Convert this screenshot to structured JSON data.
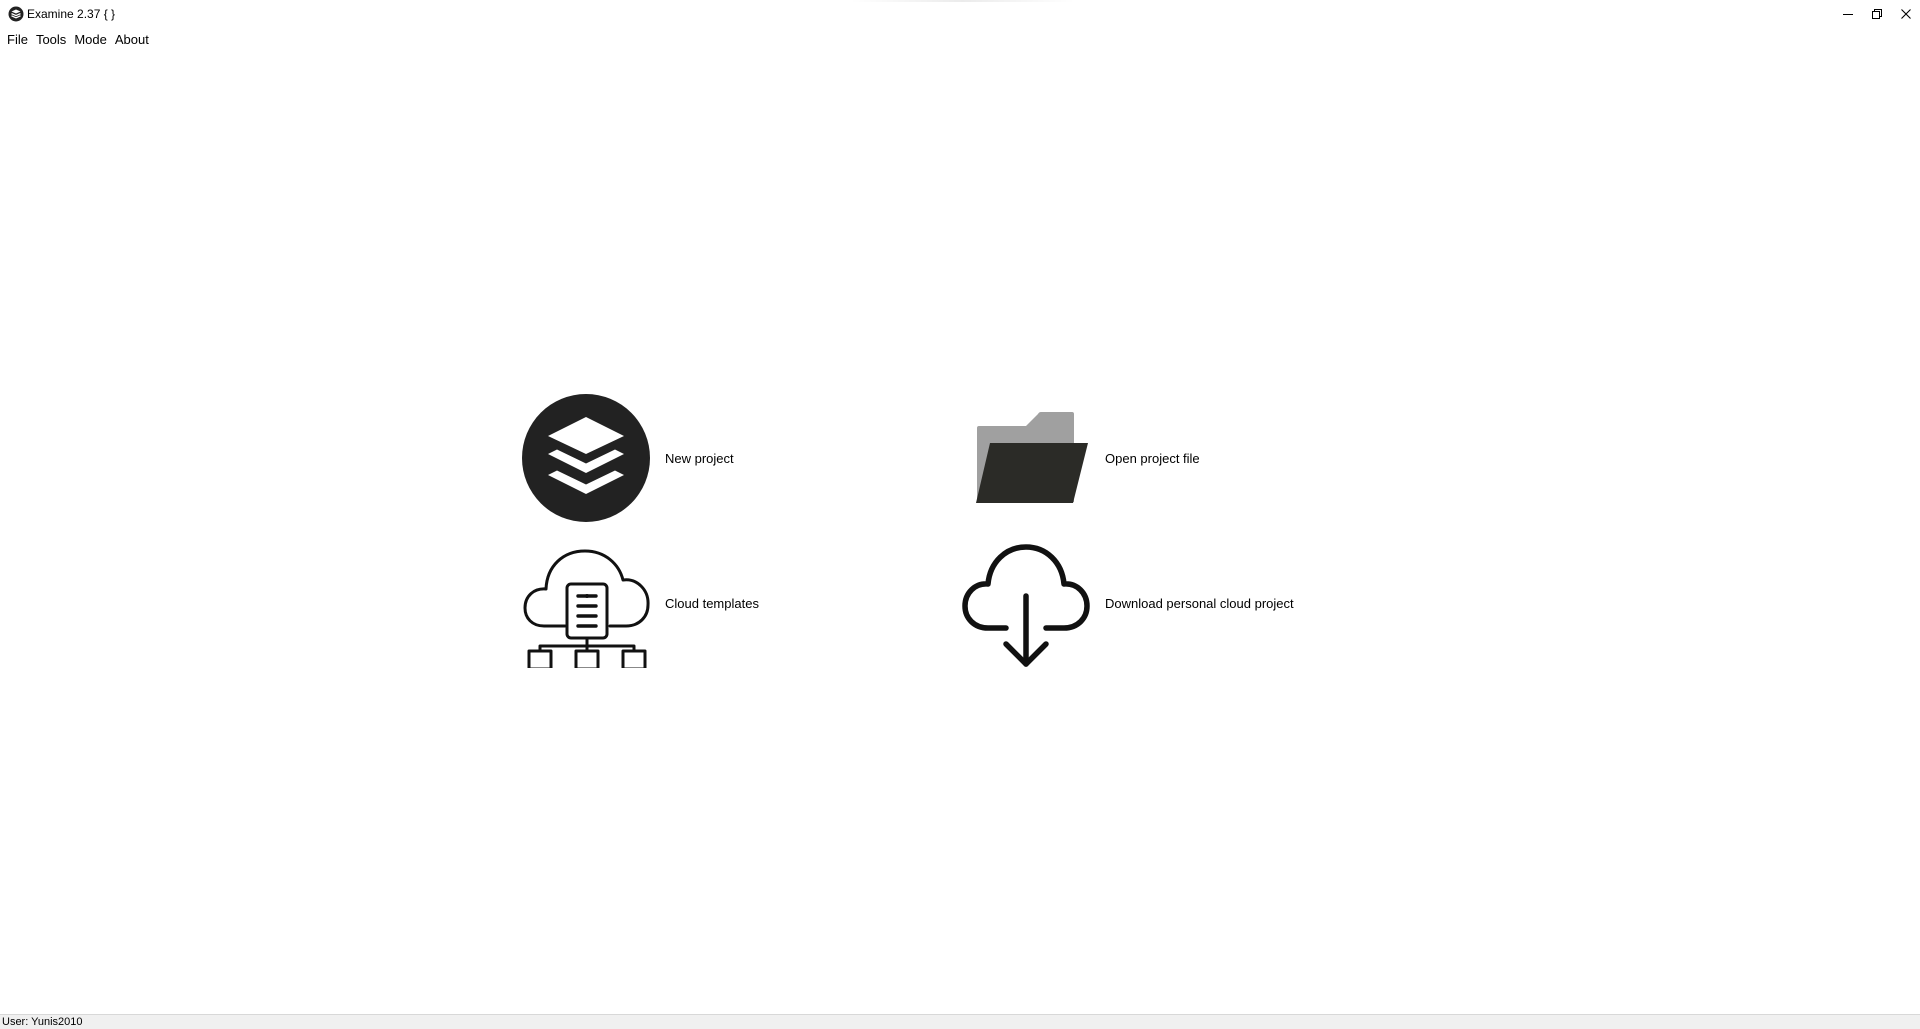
{
  "window": {
    "title": "Examine 2.37 {  }",
    "icon": "layers-icon",
    "controls": {
      "minimize": "minimize-icon",
      "restore": "restore-icon",
      "close": "close-icon"
    }
  },
  "menu": {
    "items": [
      "File",
      "Tools",
      "Mode",
      "About"
    ]
  },
  "start": {
    "new_project": {
      "label": "New project",
      "icon": "layers-icon"
    },
    "open_project": {
      "label": "Open project file",
      "icon": "folder-icon"
    },
    "cloud_templates": {
      "label": "Cloud templates",
      "icon": "cloud-network-icon"
    },
    "download_cloud": {
      "label": "Download personal cloud project",
      "icon": "cloud-download-icon"
    }
  },
  "status": {
    "user": "User: Yunis2010"
  },
  "colors": {
    "icon_dark": "#222222",
    "folder_back": "#a0a0a0",
    "folder_front": "#2b2b27",
    "statusbar_bg": "#f0f0f0"
  }
}
